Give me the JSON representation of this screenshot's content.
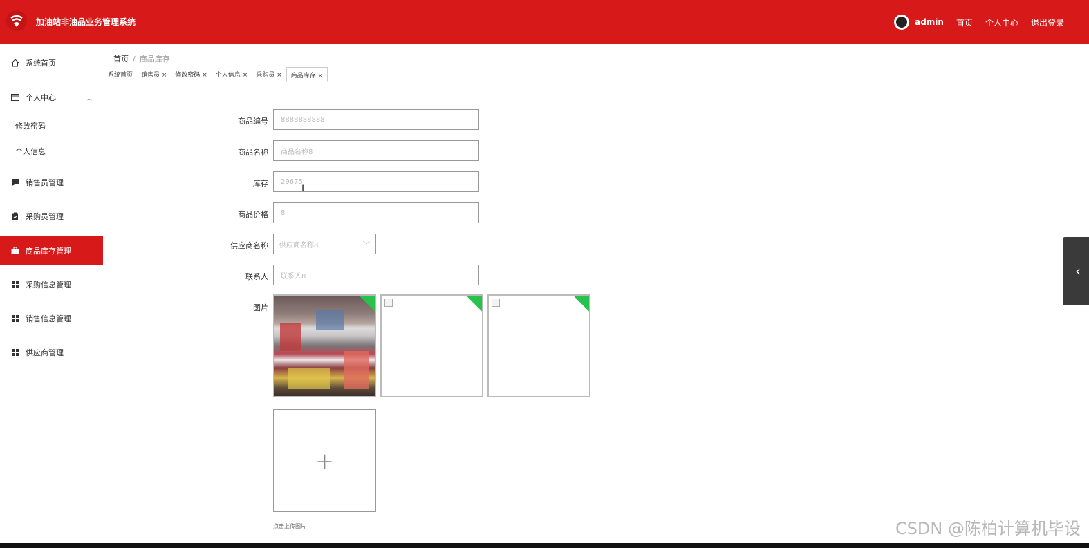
{
  "header": {
    "app_title": "加油站非油品业务管理系统",
    "username": "admin",
    "links": [
      "首页",
      "个人中心",
      "退出登录"
    ],
    "brand_color": "#d7191a",
    "logo_icon": "gas-station-logo-icon",
    "avatar_icon": "user-avatar"
  },
  "sidebar": {
    "items": [
      {
        "label": "系统首页",
        "icon": "home-icon"
      },
      {
        "label": "个人中心",
        "icon": "wallet-icon",
        "expanded": true,
        "children": [
          "修改密码",
          "个人信息"
        ]
      },
      {
        "label": "销售员管理",
        "icon": "chat-icon"
      },
      {
        "label": "采购员管理",
        "icon": "clipboard-icon"
      },
      {
        "label": "商品库存管理",
        "icon": "briefcase-icon",
        "active": true
      },
      {
        "label": "采购信息管理",
        "icon": "grid-icon"
      },
      {
        "label": "销售信息管理",
        "icon": "grid-icon"
      },
      {
        "label": "供应商管理",
        "icon": "grid-icon"
      }
    ]
  },
  "breadcrumb": {
    "home": "首页",
    "sep": "/",
    "current": "商品库存"
  },
  "tabs": [
    {
      "label": "系统首页",
      "closable": false
    },
    {
      "label": "销售员 ×",
      "closable": true
    },
    {
      "label": "修改密码 ×",
      "closable": true
    },
    {
      "label": "个人信息 ×",
      "closable": true
    },
    {
      "label": "采购员 ×",
      "closable": true
    },
    {
      "label": "商品库存 ×",
      "closable": true,
      "active": true
    }
  ],
  "form": {
    "code_label": "商品编号",
    "code_value": "8888888888",
    "name_label": "商品名称",
    "name_value": "商品名称8",
    "stock_label": "库存",
    "stock_value": "29675",
    "price_label": "商品价格",
    "price_value": "8",
    "supplier_label": "供应商名称",
    "supplier_value": "供应商名称8",
    "contact_label": "联系人",
    "contact_value": "联系人8",
    "image_label": "图片",
    "upload_tip": "点击上传图片"
  },
  "watermark": "CSDN @陈柏计算机毕设"
}
